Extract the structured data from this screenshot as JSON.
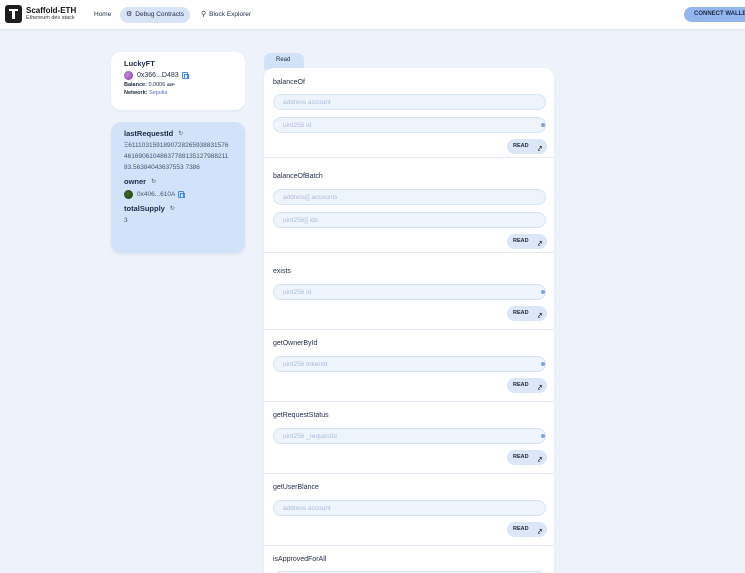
{
  "header": {
    "brand_title": "Scaffold-ETH",
    "brand_subtitle": "Ethereum dev stack",
    "nav": [
      {
        "label": "Home",
        "icon": ""
      },
      {
        "label": "Debug Contracts",
        "icon": "bug-icon"
      },
      {
        "label": "Block Explorer",
        "icon": "magnifier-icon"
      }
    ],
    "connect_label": "CONNECT WALLET"
  },
  "contract": {
    "name": "LuckyFT",
    "address": "0x366...D483",
    "balance_label": "Balance:",
    "balance_value": "0.0006",
    "balance_unit": "SEP",
    "network_label": "Network:",
    "network_value": "Sepolia"
  },
  "variables": [
    {
      "name": "lastRequestId",
      "value": "Ξ611103159189072826593883157646169061048637788135127988211 83.56384043637553 7386"
    },
    {
      "name": "owner",
      "value": "0x406...610A"
    },
    {
      "name": "totalSupply",
      "value": "3"
    }
  ],
  "tab_label": "Read",
  "read_button_label": "READ",
  "functions": [
    {
      "name": "balanceOf",
      "inputs": [
        {
          "placeholder": "address account",
          "dot": false
        },
        {
          "placeholder": "uint256 id",
          "dot": true
        }
      ]
    },
    {
      "name": "balanceOfBatch",
      "inputs": [
        {
          "placeholder": "address[] accounts",
          "dot": false
        },
        {
          "placeholder": "uint256[] ids",
          "dot": false
        }
      ]
    },
    {
      "name": "exists",
      "inputs": [
        {
          "placeholder": "uint256 id",
          "dot": true
        }
      ]
    },
    {
      "name": "getOwnerById",
      "inputs": [
        {
          "placeholder": "uint256 tokenId",
          "dot": true
        }
      ]
    },
    {
      "name": "getRequestStatus",
      "inputs": [
        {
          "placeholder": "uint256 _requestId",
          "dot": true
        }
      ]
    },
    {
      "name": "getUserBlance",
      "inputs": [
        {
          "placeholder": "address account",
          "dot": false
        }
      ]
    },
    {
      "name": "isApprovedForAll",
      "inputs": []
    }
  ],
  "colors": {
    "accent": "#93b6ef",
    "card_blue": "#d2e2f8",
    "background": "#eef3fb"
  }
}
